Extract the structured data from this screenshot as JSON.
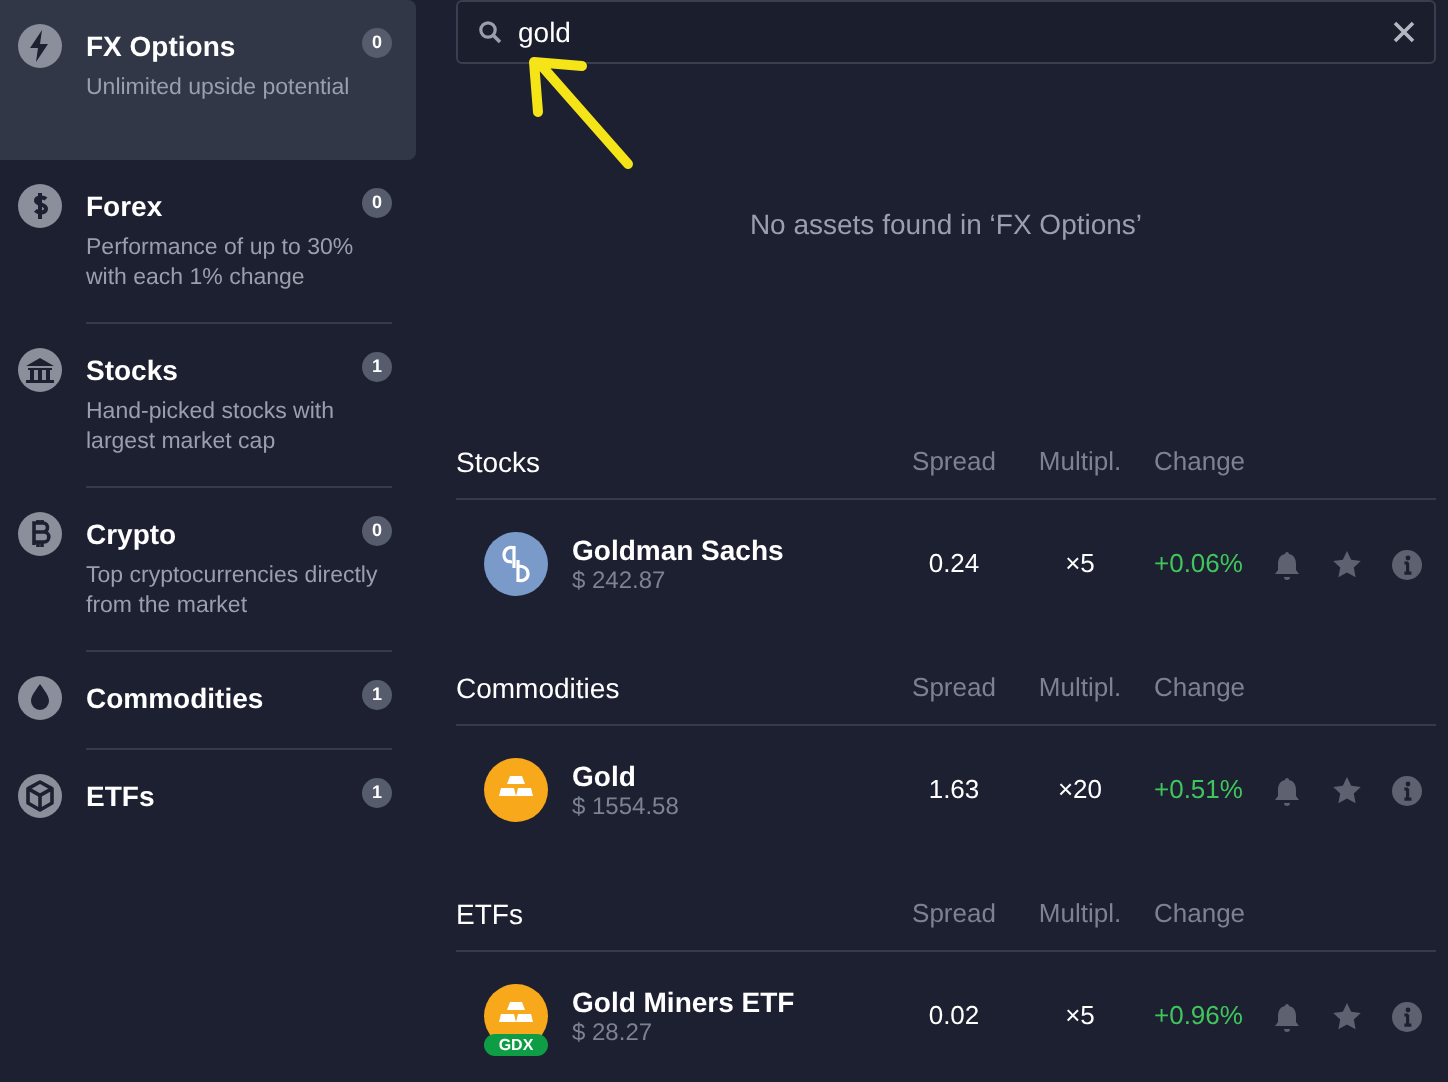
{
  "sidebar": {
    "items": [
      {
        "title": "FX Options",
        "subtitle": "Unlimited upside potential",
        "count": "0",
        "selected": true
      },
      {
        "title": "Forex",
        "subtitle": "Performance of up to 30% with each 1% change",
        "count": "0",
        "selected": false
      },
      {
        "title": "Stocks",
        "subtitle": "Hand-picked stocks with largest market cap",
        "count": "1",
        "selected": false
      },
      {
        "title": "Crypto",
        "subtitle": "Top cryptocurrencies directly from the market",
        "count": "0",
        "selected": false
      },
      {
        "title": "Commodities",
        "count": "1",
        "selected": false
      },
      {
        "title": "ETFs",
        "count": "1",
        "selected": false
      }
    ]
  },
  "search": {
    "value": "gold"
  },
  "empty_message": "No assets found in ‘FX Options’",
  "sections": [
    {
      "title": "Stocks",
      "columns": [
        "Spread",
        "Multipl.",
        "Change"
      ],
      "assets": [
        {
          "name": "Goldman Sachs",
          "price": "$ 242.87",
          "spread": "0.24",
          "multiplier": "×5",
          "change": "+0.06%"
        }
      ]
    },
    {
      "title": "Commodities",
      "columns": [
        "Spread",
        "Multipl.",
        "Change"
      ],
      "assets": [
        {
          "name": "Gold",
          "price": "$ 1554.58",
          "spread": "1.63",
          "multiplier": "×20",
          "change": "+0.51%"
        }
      ]
    },
    {
      "title": "ETFs",
      "columns": [
        "Spread",
        "Multipl.",
        "Change"
      ],
      "assets": [
        {
          "name": "Gold Miners ETF",
          "logo_badge": "GDX",
          "price": "$ 28.27",
          "spread": "0.02",
          "multiplier": "×5",
          "change": "+0.96%"
        }
      ]
    }
  ]
}
